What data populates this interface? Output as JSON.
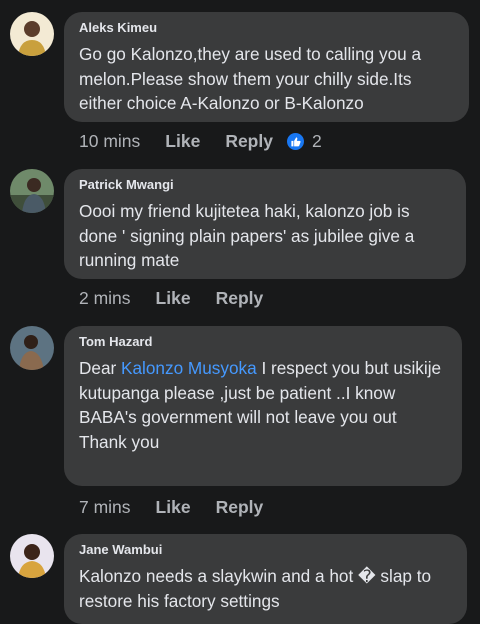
{
  "comments": [
    {
      "author": "Aleks Kimeu",
      "text": "Go go Kalonzo,they are used to calling you a melon.Please show them your chilly side.Its either choice A-Kalonzo or B-Kalonzo",
      "time": "10 mins",
      "like": "Like",
      "reply": "Reply",
      "reactions": "2"
    },
    {
      "author": "Patrick Mwangi",
      "text": "Oooi my friend kujitetea haki, kalonzo job is done ' signing plain papers' as jubilee give a running mate",
      "time": "2 mins",
      "like": "Like",
      "reply": "Reply"
    },
    {
      "author": "Tom Hazard",
      "text_prefix": "Dear ",
      "mention": "Kalonzo Musyoka",
      "text_suffix": " I respect you but usikije kutupanga please ,just be patient ..I know BABA's government will not leave you out\nThank you",
      "time": "7 mins",
      "like": "Like",
      "reply": "Reply"
    },
    {
      "author": "Jane Wambui",
      "text": "Kalonzo needs a slaykwin  and a hot � slap to restore his factory settings"
    }
  ]
}
